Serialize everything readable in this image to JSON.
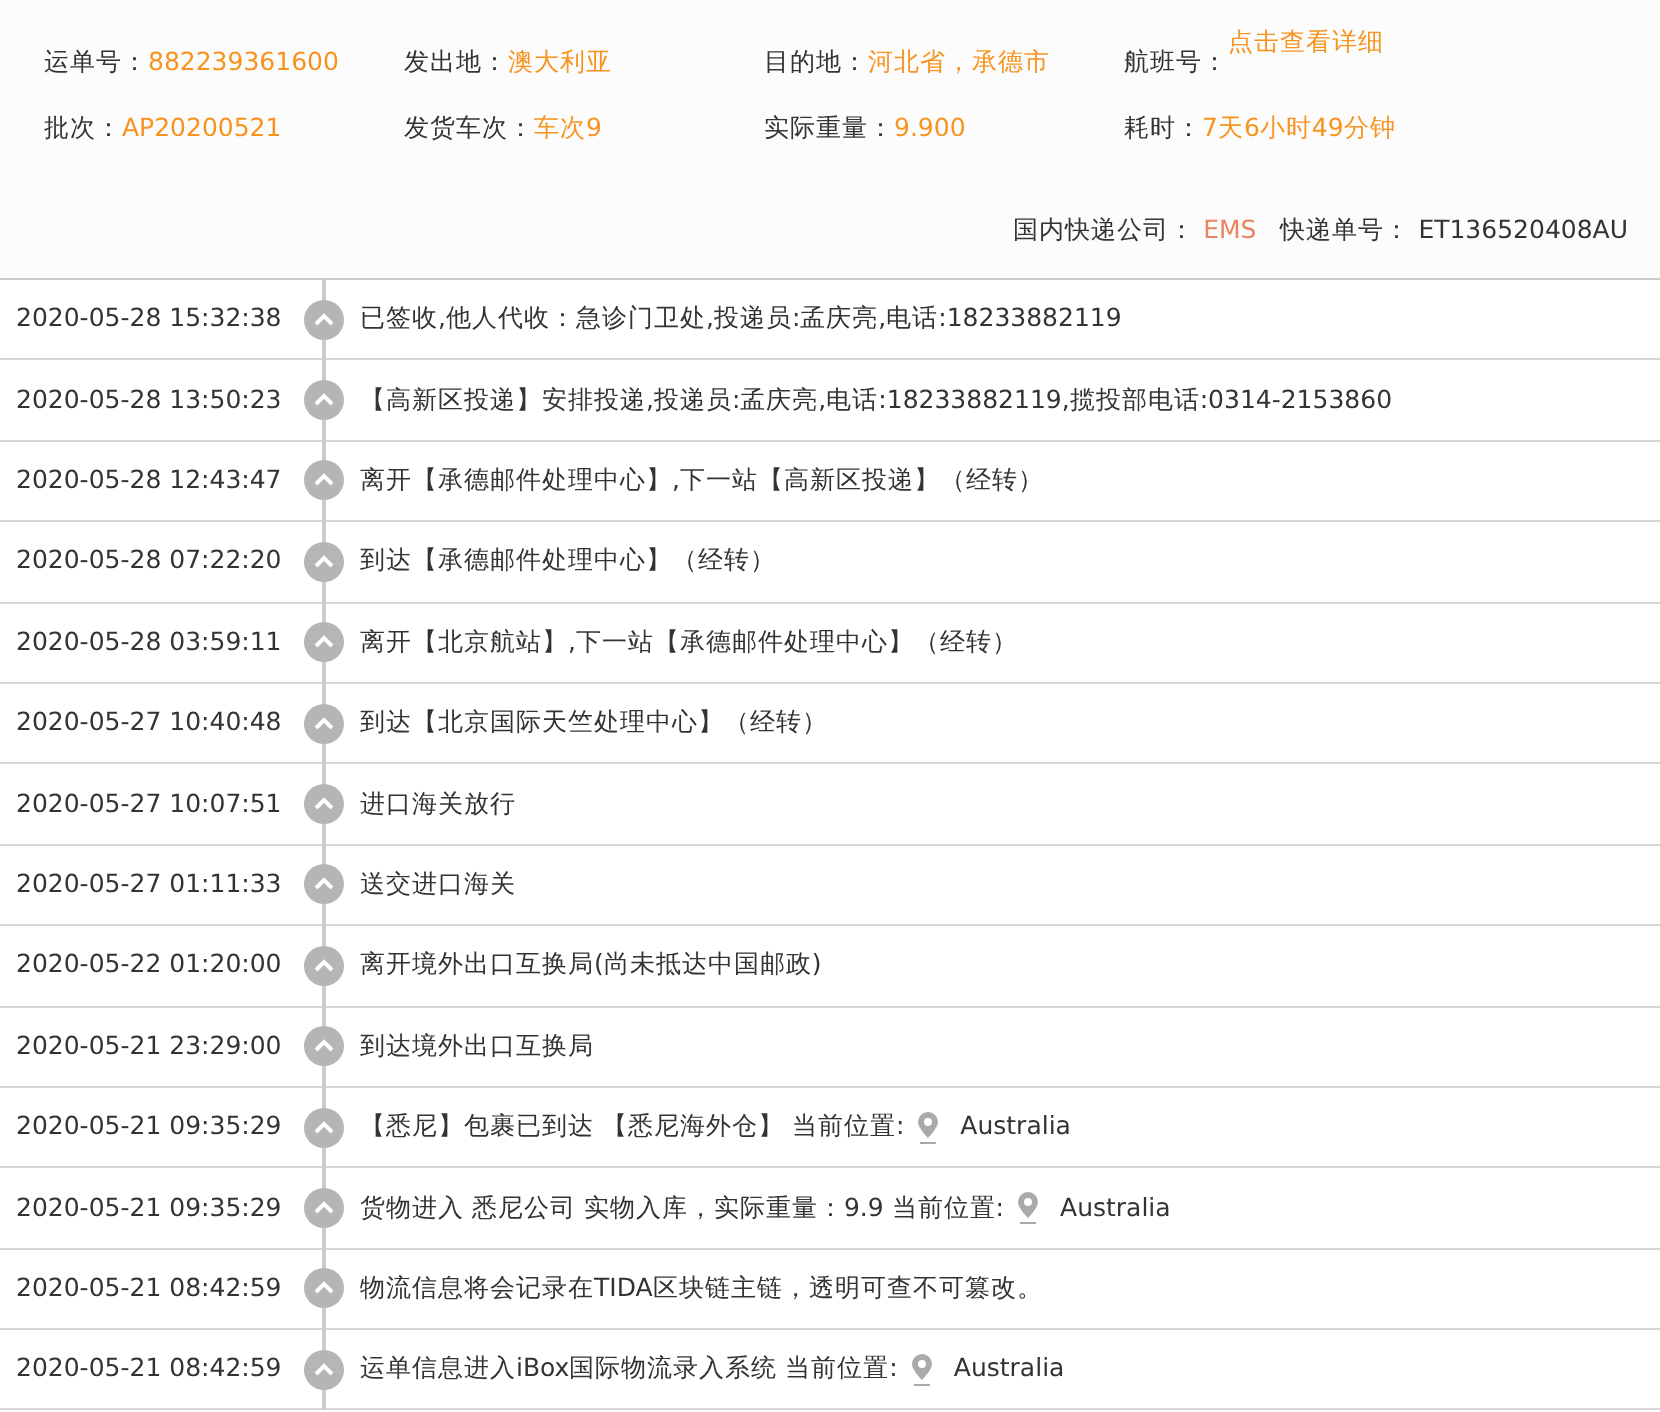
{
  "summary": [
    {
      "label": "运单号：",
      "value": "882239361600",
      "kind": "text"
    },
    {
      "label": "发出地：",
      "value": "澳大利亚",
      "kind": "text"
    },
    {
      "label": "目的地：",
      "value": "河北省，承德市",
      "kind": "text"
    },
    {
      "label": "航班号：",
      "value": "点击查看详细",
      "kind": "link"
    },
    {
      "label": "批次：",
      "value": "AP20200521",
      "kind": "text"
    },
    {
      "label": "发货车次：",
      "value": "车次9",
      "kind": "text"
    },
    {
      "label": "实际重量：",
      "value": "9.900",
      "kind": "text"
    },
    {
      "label": "耗时：",
      "value": "7天6小时49分钟",
      "kind": "text"
    }
  ],
  "courier": {
    "company_label": "国内快递公司：",
    "company": "EMS",
    "number_label": "快递单号：",
    "number": "ET136520408AU"
  },
  "events": [
    {
      "time": "2020-05-28 15:32:38",
      "text": "已签收,他人代收：急诊门卫处,投递员:孟庆亮,电话:18233882119"
    },
    {
      "time": "2020-05-28 13:50:23",
      "text": "【高新区投递】安排投递,投递员:孟庆亮,电话:18233882119,揽投部电话:0314-2153860"
    },
    {
      "time": "2020-05-28 12:43:47",
      "text": "离开【承德邮件处理中心】,下一站【高新区投递】（经转）"
    },
    {
      "time": "2020-05-28 07:22:20",
      "text": "到达【承德邮件处理中心】（经转）"
    },
    {
      "time": "2020-05-28 03:59:11",
      "text": "离开【北京航站】,下一站【承德邮件处理中心】（经转）"
    },
    {
      "time": "2020-05-27 10:40:48",
      "text": "到达【北京国际天竺处理中心】（经转）"
    },
    {
      "time": "2020-05-27 10:07:51",
      "text": "进口海关放行"
    },
    {
      "time": "2020-05-27 01:11:33",
      "text": "送交进口海关"
    },
    {
      "time": "2020-05-22 01:20:00",
      "text": "离开境外出口互换局(尚未抵达中国邮政)"
    },
    {
      "time": "2020-05-21 23:29:00",
      "text": "到达境外出口互换局"
    },
    {
      "time": "2020-05-21 09:35:29",
      "text": "【悉尼】包裹已到达 【悉尼海外仓】 当前位置:",
      "location": "Australia"
    },
    {
      "time": "2020-05-21 09:35:29",
      "text": "货物进入 悉尼公司 实物入库，实际重量：9.9 当前位置:",
      "location": "Australia"
    },
    {
      "time": "2020-05-21 08:42:59",
      "text": "物流信息将会记录在TIDA区块链主链，透明可查不可篡改。"
    },
    {
      "time": "2020-05-21 08:42:59",
      "text": "运单信息进入iBox国际物流录入系统 当前位置:",
      "location": "Australia"
    }
  ]
}
